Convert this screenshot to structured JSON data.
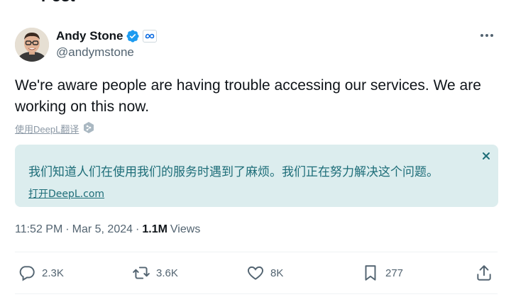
{
  "header": {
    "title": "Post",
    "back_icon": "arrow-left-icon"
  },
  "author": {
    "display_name": "Andy Stone",
    "handle": "@andymstone",
    "verified_icon": "verified-badge-icon",
    "affiliation_icon": "meta-logo-icon",
    "verified_color": "#1d9bf0"
  },
  "tweet": {
    "text": "We're aware people are having trouble accessing our services. We are working on this now.",
    "translate_link": "使用DeepL翻译",
    "translation": "我们知道人们在使用我们的服务时遇到了麻烦。我们正在努力解决这个问题。",
    "open_deepl": "打开DeepL.com",
    "time": "11:52 PM",
    "date": "Mar 5, 2024",
    "views_count": "1.1M",
    "views_label": "Views"
  },
  "actions": {
    "replies": "2.3K",
    "reposts": "3.6K",
    "likes": "8K",
    "bookmarks": "277"
  },
  "colors": {
    "text": "#0f1419",
    "muted": "#536471",
    "translation_bg": "#dcedee",
    "translation_text": "#1d6d78"
  }
}
